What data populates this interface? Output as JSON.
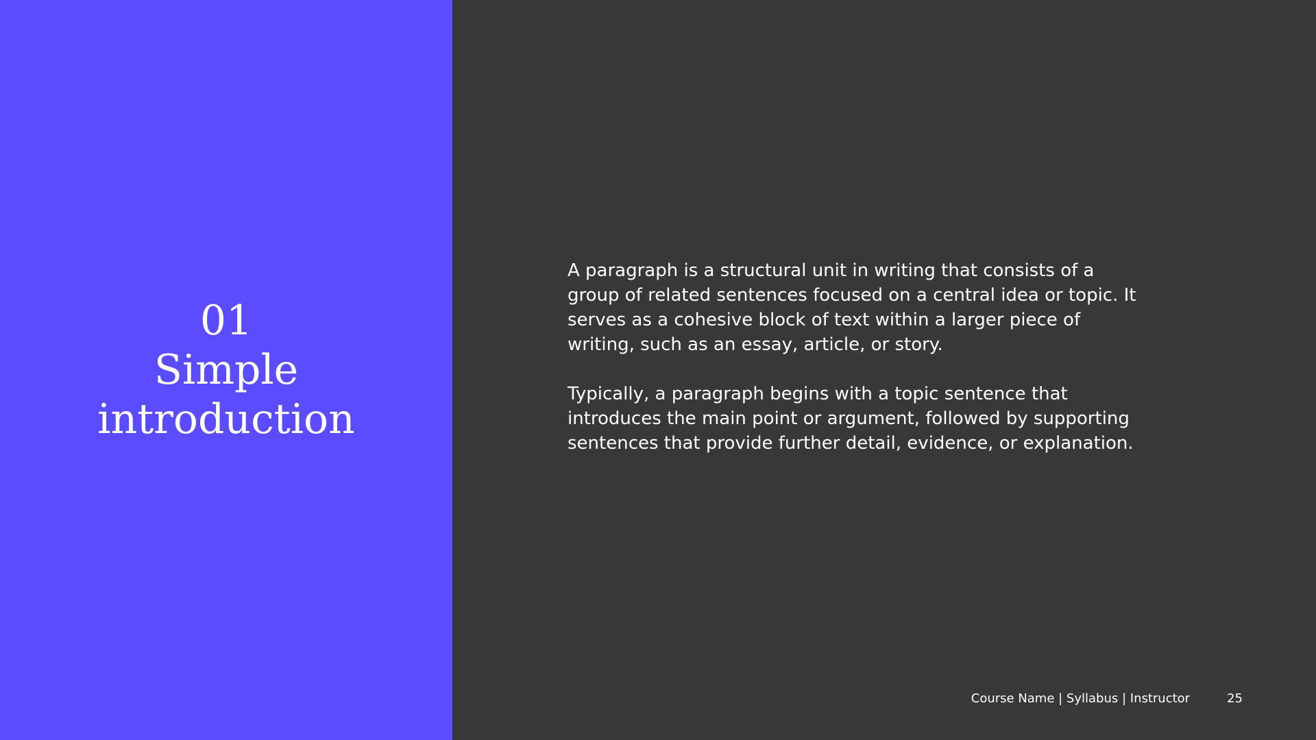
{
  "colors": {
    "left_panel_bg": "#5b4dff",
    "right_panel_bg": "#383838",
    "text": "#ffffff"
  },
  "section": {
    "number": "01",
    "title_line1": "Simple",
    "title_line2": "introduction"
  },
  "body": {
    "paragraphs": [
      "A paragraph is a structural unit in writing that consists of a group of related sentences focused on a central idea or topic. It serves as a cohesive block of text within a larger piece of writing, such as an essay, article, or story.",
      "Typically, a paragraph begins with a topic sentence that introduces the main point or argument, followed by supporting sentences that provide further detail, evidence, or explanation."
    ]
  },
  "footer": {
    "meta": "Course Name | Syllabus | Instructor",
    "page_number": "25"
  }
}
